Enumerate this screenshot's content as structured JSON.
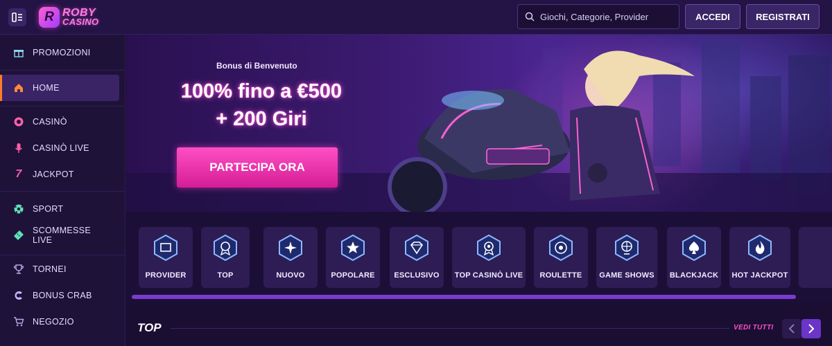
{
  "header": {
    "logo_line1": "ROBY",
    "logo_line2": "CASINO",
    "logo_mark": "R",
    "search_placeholder": "Giochi, Categorie, Provider",
    "login_label": "ACCEDI",
    "register_label": "REGISTRATI"
  },
  "sidebar": {
    "items": [
      {
        "label": "PROMOZIONI",
        "icon": "gift-icon"
      },
      {
        "label": "HOME",
        "icon": "home-icon",
        "active": true
      },
      {
        "label": "CASINÒ",
        "icon": "casino-chip-icon"
      },
      {
        "label": "CASINÒ LIVE",
        "icon": "microphone-icon"
      },
      {
        "label": "JACKPOT",
        "icon": "seven-icon"
      },
      {
        "label": "SPORT",
        "icon": "soccer-ball-icon"
      },
      {
        "label": "SCOMMESSE\nLIVE",
        "icon": "ticket-icon"
      },
      {
        "label": "TORNEI",
        "icon": "trophy-icon"
      },
      {
        "label": "BONUS CRAB",
        "icon": "crab-icon"
      },
      {
        "label": "NEGOZIO",
        "icon": "cart-icon"
      }
    ]
  },
  "banner": {
    "subtitle": "Bonus di Benvenuto",
    "title_line1": "100% fino a €500",
    "title_line2": "+ 200 Giri",
    "cta_label": "PARTECIPA ORA"
  },
  "categories": [
    {
      "label": "PROVIDER",
      "icon": "folder-icon"
    },
    {
      "label": "TOP",
      "icon": "medal-star-icon"
    },
    {
      "label": "NUOVO",
      "icon": "sparkle-icon"
    },
    {
      "label": "POPOLARE",
      "icon": "star-icon"
    },
    {
      "label": "ESCLUSIVO",
      "icon": "diamond-icon"
    },
    {
      "label": "TOP CASINÒ LIVE",
      "icon": "live-medal-icon"
    },
    {
      "label": "ROULETTE",
      "icon": "roulette-icon"
    },
    {
      "label": "GAME SHOWS",
      "icon": "wheel-icon"
    },
    {
      "label": "BLACKJACK",
      "icon": "spade-icon"
    },
    {
      "label": "HOT JACKPOT",
      "icon": "flame-icon"
    }
  ],
  "section": {
    "title": "TOP",
    "see_all_label": "VEDI TUTTI"
  },
  "colors": {
    "accent_pink": "#ff4fc4",
    "active_orange": "#ff7a2a",
    "bg_dark": "#1a1030",
    "scroll_purple": "#7a3bd0"
  }
}
